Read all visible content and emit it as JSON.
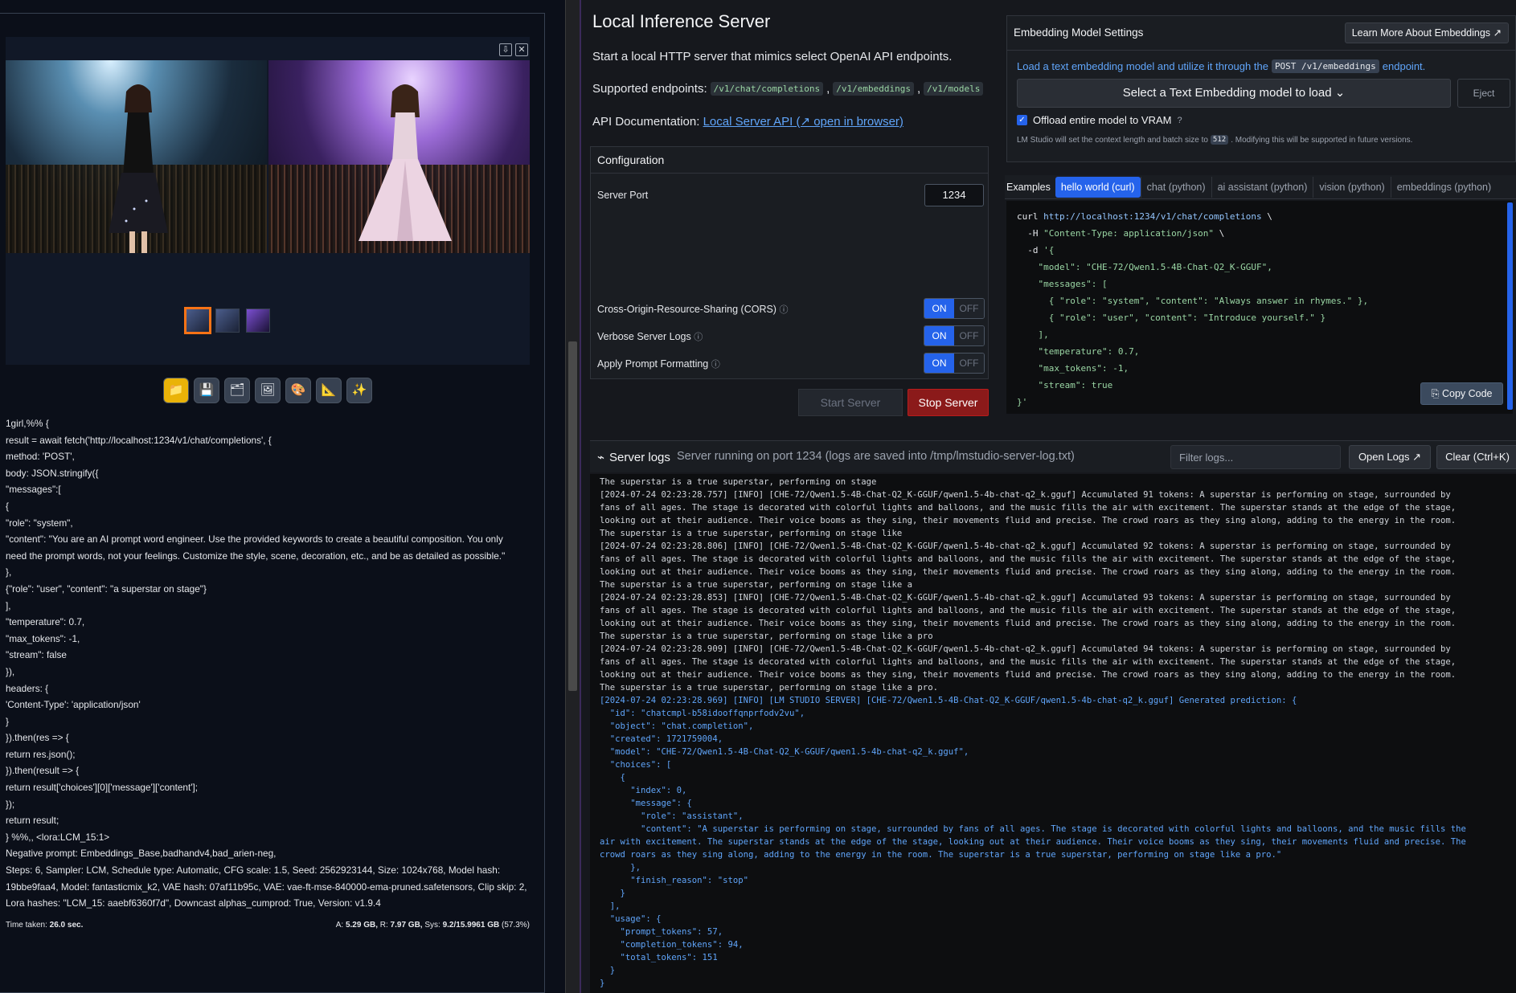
{
  "left": {
    "gallery": {
      "download_label": "⇩",
      "close_label": "✕"
    },
    "tools": [
      "📁",
      "💾",
      "🗂",
      "🖼",
      "🎨",
      "📐",
      "✨"
    ],
    "gen_info_lines": [
      "1girl,%% {",
      "result = await fetch('http://localhost:1234/v1/chat/completions', {",
      "method: 'POST',",
      "body: JSON.stringify({",
      "\"messages\":[",
      "{",
      "\"role\": \"system\",",
      "\"content\": \"You are an AI prompt word engineer. Use the provided keywords to create a beautiful composition. You only",
      "need the prompt words, not your feelings. Customize the style, scene, decoration, etc., and be as detailed as possible.\"",
      "},",
      "{\"role\": \"user\", \"content\": \"a superstar on stage\"}",
      "],",
      "\"temperature\": 0.7,",
      "\"max_tokens\": -1,",
      "\"stream\": false",
      "}),",
      "headers: {",
      "'Content-Type': 'application/json'",
      "}",
      "}).then(res => {",
      "return res.json();",
      "}).then(result => {",
      "return result['choices'][0]['message']['content'];",
      "});",
      "return result;",
      "} %%,, <lora:LCM_15:1>",
      "Negative prompt: Embeddings_Base,badhandv4,bad_arien-neg,",
      "Steps: 6, Sampler: LCM, Schedule type: Automatic, CFG scale: 1.5, Seed: 2562923144, Size: 1024x768, Model hash:",
      "19bbe9faa4, Model: fantasticmix_k2, VAE hash: 07af11b95c, VAE: vae-ft-mse-840000-ema-pruned.safetensors, Clip skip: 2,",
      "Lora hashes: \"LCM_15: aaebf6360f7d\", Downcast alphas_cumprod: True, Version: v1.9.4"
    ],
    "time_label": "Time taken:",
    "time_value": "26.0 sec.",
    "mem_a_label": "A:",
    "mem_a_value": "5.29 GB,",
    "mem_r_label": "R:",
    "mem_r_value": "7.97 GB,",
    "mem_sys_label": "Sys:",
    "mem_sys_value": "9.2/15.9961 GB",
    "mem_pct": "(57.3%)"
  },
  "server": {
    "title": "Local Inference Server",
    "description": "Start a local HTTP server that mimics select OpenAI API endpoints.",
    "endpoints_label": "Supported endpoints:",
    "endpoints": [
      "/v1/chat/completions",
      "/v1/embeddings",
      "/v1/models"
    ],
    "doc_label": "API Documentation:",
    "doc_link": "Local Server API (↗ open in browser)"
  },
  "config": {
    "title": "Configuration",
    "port_label": "Server Port",
    "port_value": "1234",
    "cors_label": "Cross-Origin-Resource-Sharing (CORS)",
    "verbose_label": "Verbose Server Logs",
    "prompt_fmt_label": "Apply Prompt Formatting",
    "on_label": "ON",
    "off_label": "OFF",
    "info_glyph": "ⓘ",
    "start_label": "Start Server",
    "stop_label": "Stop Server"
  },
  "embedding": {
    "title": "Embedding Model Settings",
    "learn_label": "Learn More About Embeddings ↗",
    "desc_prefix": "Load a text embedding model and utilize it through the",
    "desc_code": "POST /v1/embeddings",
    "desc_suffix": "endpoint.",
    "select_label": "Select a Text Embedding model to load ⌄",
    "eject_label": "Eject",
    "offload_label": "Offload entire model to VRAM",
    "note_prefix": "LM Studio will set the context length and batch size to",
    "note_code": "512",
    "note_suffix": ". Modifying this will be supported in future versions."
  },
  "examples": {
    "label": "Examples",
    "tabs": [
      "hello world (curl)",
      "chat (python)",
      "ai assistant (python)",
      "vision (python)",
      "embeddings (python)"
    ],
    "copy_label": "Copy Code"
  },
  "logs": {
    "title": "Server logs",
    "status": "Server running on port 1234 (logs are saved into /tmp/lmstudio-server-log.txt)",
    "filter_placeholder": "Filter logs...",
    "open_label": "Open Logs ↗",
    "clear_label": "Clear (Ctrl+K)"
  },
  "colors": {
    "accent": "#2563eb",
    "stop": "#8b1a1a",
    "link": "#60a5fa"
  }
}
